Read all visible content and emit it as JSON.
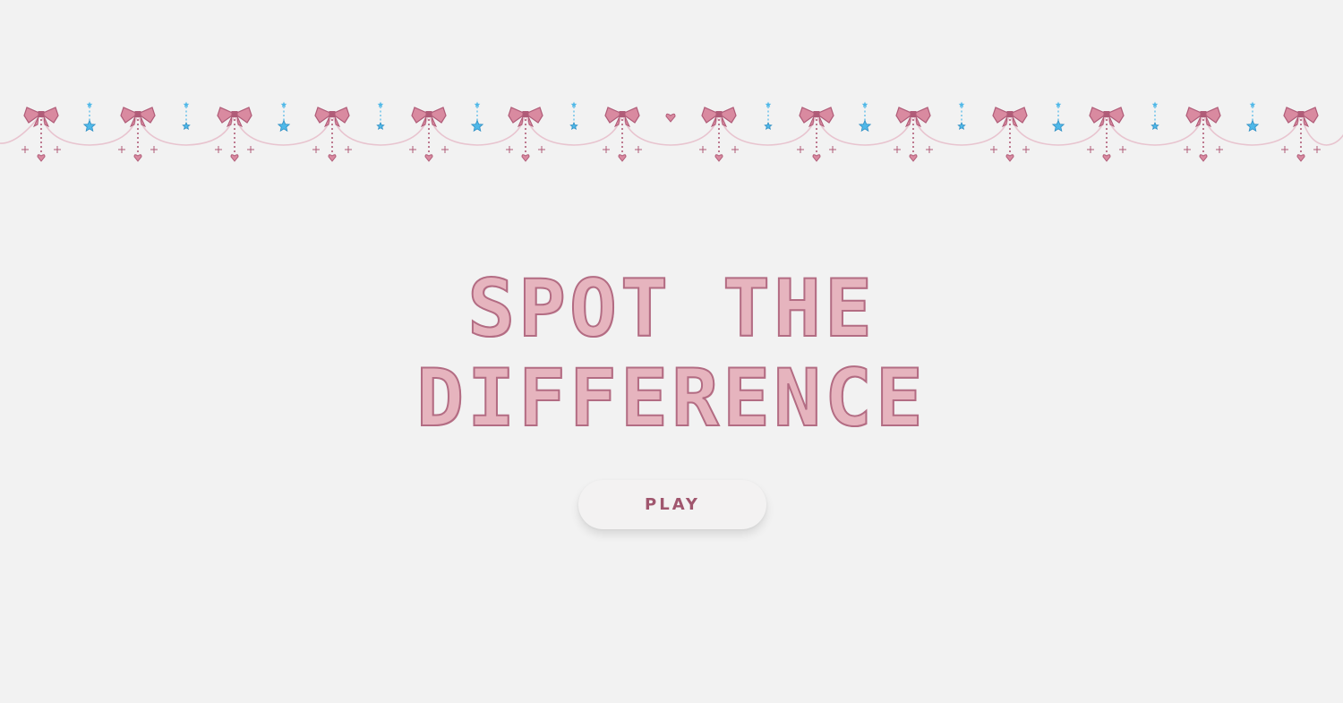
{
  "title": {
    "line1": "SPOT THE",
    "line2": "DIFFERENCE"
  },
  "play_button": {
    "label": "PLAY"
  },
  "decoration": {
    "bow_icon": "pink-ribbon-bow-icon",
    "star_icon": "blue-star-icon",
    "heart_icon": "pink-heart-icon",
    "bow_color": "#d98aa0",
    "bow_outline": "#b05c78",
    "star_color": "#4fb8e8",
    "chain_color": "#e8c4cf"
  },
  "colors": {
    "background": "#f2f2f2",
    "title_fill": "#e6b4be",
    "title_outline": "#b36c83",
    "button_text": "#a0566e"
  }
}
